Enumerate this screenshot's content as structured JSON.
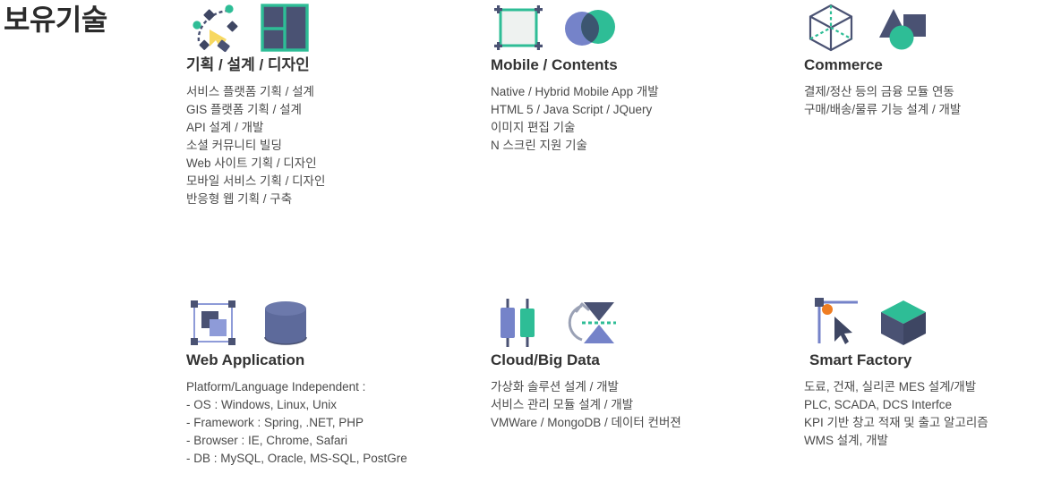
{
  "page": {
    "title": "보유기술"
  },
  "sections": [
    {
      "id": "planning-design",
      "title": "기획 / 설계 / 디자인",
      "icons": [
        "pen-tool-icon",
        "wireframe-layout-icon"
      ],
      "items": [
        "서비스 플랫폼 기획 / 설계",
        "GIS 플랫폼 기획 / 설계",
        "API 설계 / 개발",
        "소셜 커뮤니티 빌딩",
        "Web 사이트 기획 / 디자인",
        "모바일 서비스 기획 / 디자인",
        "반응형 웹 기획 / 구축"
      ]
    },
    {
      "id": "mobile-contents",
      "title": "Mobile / Contents",
      "icons": [
        "selection-frame-icon",
        "venn-circles-icon"
      ],
      "items": [
        "Native / Hybrid Mobile App 개발",
        "HTML 5 / Java Script / JQuery",
        "이미지 편집 기술",
        "N 스크린 지원 기술"
      ]
    },
    {
      "id": "commerce",
      "title": "Commerce",
      "icons": [
        "wireframe-cube-icon",
        "shapes-icon"
      ],
      "items": [
        "결제/정산 등의 금융 모듈 연동",
        "구매/배송/물류 기능 설계 / 개발"
      ]
    },
    {
      "id": "web-application",
      "title": "Web Application",
      "icons": [
        "group-select-icon",
        "database-cylinder-icon"
      ],
      "items": [
        "Platform/Language Independent :",
        " - OS : Windows, Linux, Unix",
        " - Framework : Spring, .NET, PHP",
        " - Browser : IE, Chrome, Safari",
        " - DB : MySQL, Oracle, MS-SQL, PostGre"
      ]
    },
    {
      "id": "cloud-big-data",
      "title": "Cloud/Big Data",
      "icons": [
        "candlestick-icon",
        "flip-transform-icon"
      ],
      "items": [
        "가상화 솔루션 설계 / 개발",
        "서비스 관리 모듈 설계 / 개발",
        "VMWare / MongoDB / 데이터 컨버젼"
      ]
    },
    {
      "id": "smart-factory",
      "title": " Smart Factory",
      "icons": [
        "guides-cursor-icon",
        "solid-cube-icon"
      ],
      "items": [
        "도료, 건재, 실리콘  MES 설계/개발",
        "PLC, SCADA, DCS Interfce",
        "KPI 기반 창고 적재 및 출고 알고리즘",
        "WMS 설계, 개발"
      ]
    }
  ],
  "palette": {
    "dark_slate": "#4a5273",
    "teal": "#2ebd96",
    "periwinkle": "#7583c9",
    "yellow": "#f7d860",
    "orange": "#ef7d22",
    "text_dark": "#333333",
    "text_body": "#4a4a4a"
  }
}
